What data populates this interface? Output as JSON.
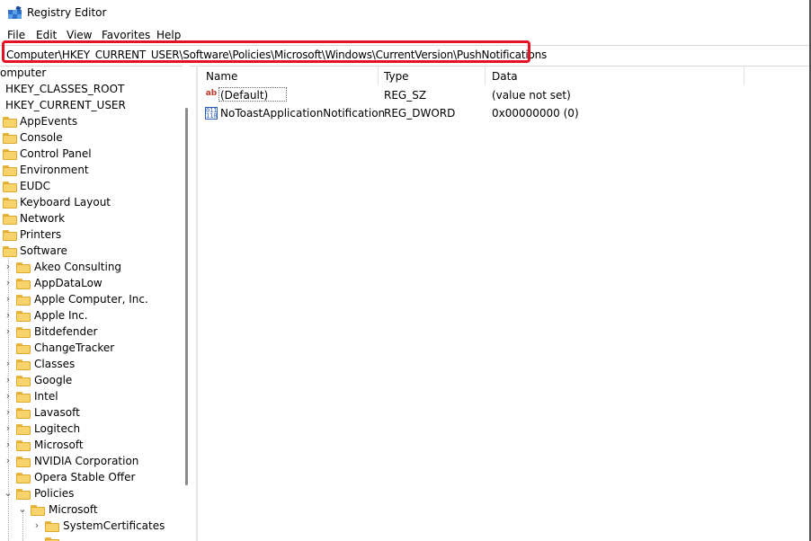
{
  "window": {
    "title": "Registry Editor"
  },
  "menu": [
    "File",
    "Edit",
    "View",
    "Favorites",
    "Help"
  ],
  "address": {
    "path": "Computer\\HKEY_CURRENT_USER\\Software\\Policies\\Microsoft\\Windows\\CurrentVersion\\PushNotifications"
  },
  "tree": {
    "items": [
      {
        "label": "omputer"
      },
      {
        "label": "HKEY_CLASSES_ROOT"
      },
      {
        "label": "HKEY_CURRENT_USER"
      },
      {
        "label": "AppEvents"
      },
      {
        "label": "Console"
      },
      {
        "label": "Control Panel"
      },
      {
        "label": "Environment"
      },
      {
        "label": "EUDC"
      },
      {
        "label": "Keyboard Layout"
      },
      {
        "label": "Network"
      },
      {
        "label": "Printers"
      },
      {
        "label": "Software"
      },
      {
        "label": "Akeo Consulting"
      },
      {
        "label": "AppDataLow"
      },
      {
        "label": "Apple Computer, Inc."
      },
      {
        "label": "Apple Inc."
      },
      {
        "label": "Bitdefender"
      },
      {
        "label": "ChangeTracker"
      },
      {
        "label": "Classes"
      },
      {
        "label": "Google"
      },
      {
        "label": "Intel"
      },
      {
        "label": "Lavasoft"
      },
      {
        "label": "Logitech"
      },
      {
        "label": "Microsoft"
      },
      {
        "label": "NVIDIA Corporation"
      },
      {
        "label": "Opera Stable Offer"
      },
      {
        "label": "Policies"
      },
      {
        "label": "Microsoft"
      },
      {
        "label": "SystemCertificates"
      }
    ]
  },
  "list": {
    "columns": [
      "Name",
      "Type",
      "Data"
    ],
    "rows": [
      {
        "name": "(Default)",
        "type": "REG_SZ",
        "data": "(value not set)",
        "icon": "string-value-icon"
      },
      {
        "name": "NoToastApplicationNotification",
        "type": "REG_DWORD",
        "data": "0x00000000 (0)",
        "icon": "dword-value-icon"
      }
    ]
  },
  "colors": {
    "highlight": "#e81123",
    "folder": "#f8d26a"
  }
}
